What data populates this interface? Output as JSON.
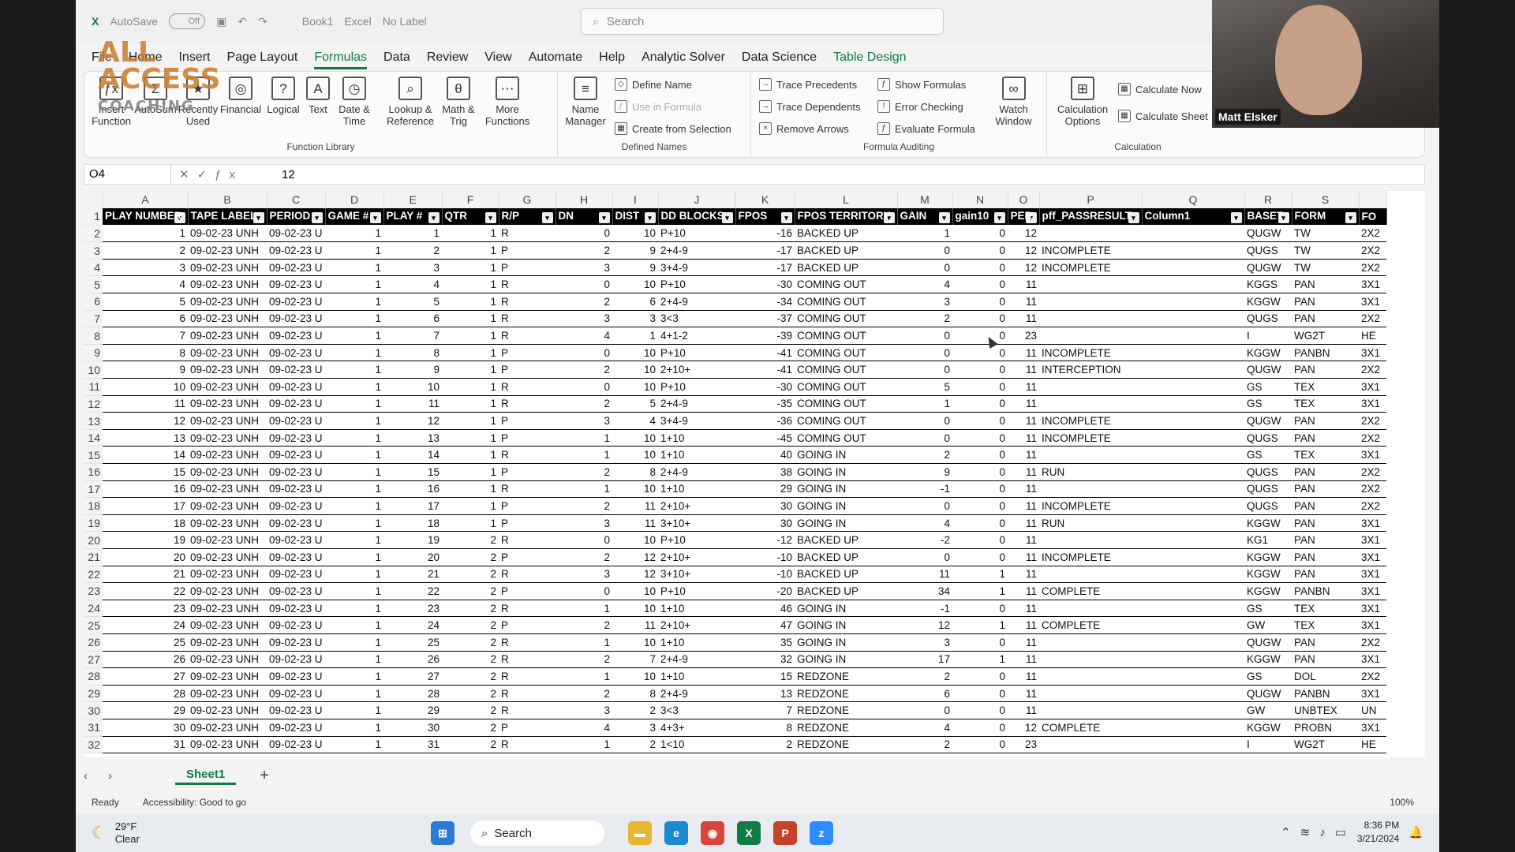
{
  "titlebar": {
    "autosave": "AutoSave",
    "autosave_state": "Off",
    "book": "Book1",
    "app": "Excel",
    "label": "No Label",
    "search_placeholder": "Search"
  },
  "logo": {
    "line1": "ALL ACCESS",
    "line2": "COACHING"
  },
  "menu_tabs": [
    "File",
    "Home",
    "Insert",
    "Page Layout",
    "Formulas",
    "Data",
    "Review",
    "View",
    "Automate",
    "Help",
    "Analytic Solver",
    "Data Science",
    "Table Design"
  ],
  "active_tab": "Formulas",
  "ribbon": {
    "function_library": {
      "label": "Function Library",
      "buttons": [
        {
          "label": "Insert Function",
          "icon": "fx-icon"
        },
        {
          "label": "AutoSum",
          "icon": "sigma-icon"
        },
        {
          "label": "Recently Used",
          "icon": "star-icon"
        },
        {
          "label": "Financial",
          "icon": "coins-icon"
        },
        {
          "label": "Logical",
          "icon": "question-icon"
        },
        {
          "label": "Text",
          "icon": "text-icon"
        },
        {
          "label": "Date & Time",
          "icon": "clock-icon"
        },
        {
          "label": "Lookup & Reference",
          "icon": "magnifier-icon"
        },
        {
          "label": "Math & Trig",
          "icon": "theta-icon"
        },
        {
          "label": "More Functions",
          "icon": "dots-icon"
        }
      ]
    },
    "defined_names": {
      "label": "Defined Names",
      "name_manager": "Name Manager",
      "define_name": "Define Name",
      "use_in_formula": "Use in Formula",
      "create_from_selection": "Create from Selection"
    },
    "formula_auditing": {
      "label": "Formula Auditing",
      "trace_precedents": "Trace Precedents",
      "trace_dependents": "Trace Dependents",
      "remove_arrows": "Remove Arrows",
      "show_formulas": "Show Formulas",
      "error_checking": "Error Checking",
      "evaluate_formula": "Evaluate Formula",
      "watch_window": "Watch Window"
    },
    "calculation": {
      "label": "Calculation",
      "calculation_options": "Calculation Options",
      "calculate_now": "Calculate Now",
      "calculate_sheet": "Calculate Sheet"
    }
  },
  "formula_bar": {
    "name_box": "O4",
    "value": "12"
  },
  "column_letters": [
    "A",
    "B",
    "C",
    "D",
    "E",
    "F",
    "G",
    "H",
    "I",
    "J",
    "K",
    "L",
    "M",
    "N",
    "O",
    "P",
    "Q",
    "R",
    "S",
    ""
  ],
  "header_cells": [
    "PLAY NUMBER",
    "TAPE LABEL",
    "PERIOD",
    "GAME #",
    "PLAY #",
    "QTR",
    "R/P",
    "DN",
    "DIST",
    "DD BLOCKS",
    "FPOS",
    "FPOS TERRITORY",
    "GAIN",
    "gain10",
    "PER",
    "pff_PASSRESULT",
    "Column1",
    "BASET",
    "FORM",
    "FO"
  ],
  "rows": [
    [
      "1",
      "09-02-23 UNH",
      "09-02-23 U",
      "1",
      "1",
      "1",
      "R",
      "0",
      "10",
      "P+10",
      "-16",
      "BACKED UP",
      "1",
      "0",
      "12",
      "",
      "",
      "QUGW",
      "TW",
      "2X2"
    ],
    [
      "2",
      "09-02-23 UNH",
      "09-02-23 U",
      "1",
      "2",
      "1",
      "P",
      "2",
      "9",
      "2+4-9",
      "-17",
      "BACKED UP",
      "0",
      "0",
      "12",
      "INCOMPLETE",
      "",
      "QUGS",
      "TW",
      "2X2"
    ],
    [
      "3",
      "09-02-23 UNH",
      "09-02-23 U",
      "1",
      "3",
      "1",
      "P",
      "3",
      "9",
      "3+4-9",
      "-17",
      "BACKED UP",
      "0",
      "0",
      "12",
      "INCOMPLETE",
      "",
      "QUGW",
      "TW",
      "2X2"
    ],
    [
      "4",
      "09-02-23 UNH",
      "09-02-23 U",
      "1",
      "4",
      "1",
      "R",
      "0",
      "10",
      "P+10",
      "-30",
      "COMING OUT",
      "4",
      "0",
      "11",
      "",
      "",
      "KGGS",
      "PAN",
      "3X1"
    ],
    [
      "5",
      "09-02-23 UNH",
      "09-02-23 U",
      "1",
      "5",
      "1",
      "R",
      "2",
      "6",
      "2+4-9",
      "-34",
      "COMING OUT",
      "3",
      "0",
      "11",
      "",
      "",
      "KGGW",
      "PAN",
      "3X1"
    ],
    [
      "6",
      "09-02-23 UNH",
      "09-02-23 U",
      "1",
      "6",
      "1",
      "R",
      "3",
      "3",
      "3<3",
      "-37",
      "COMING OUT",
      "2",
      "0",
      "11",
      "",
      "",
      "QUGS",
      "PAN",
      "2X2"
    ],
    [
      "7",
      "09-02-23 UNH",
      "09-02-23 U",
      "1",
      "7",
      "1",
      "R",
      "4",
      "1",
      "4+1-2",
      "-39",
      "COMING OUT",
      "0",
      "0",
      "23",
      "",
      "",
      "I",
      "WG2T",
      "HE"
    ],
    [
      "8",
      "09-02-23 UNH",
      "09-02-23 U",
      "1",
      "8",
      "1",
      "P",
      "0",
      "10",
      "P+10",
      "-41",
      "COMING OUT",
      "0",
      "0",
      "11",
      "INCOMPLETE",
      "",
      "KGGW",
      "PANBN",
      "3X1"
    ],
    [
      "9",
      "09-02-23 UNH",
      "09-02-23 U",
      "1",
      "9",
      "1",
      "P",
      "2",
      "10",
      "2+10+",
      "-41",
      "COMING OUT",
      "0",
      "0",
      "11",
      "INTERCEPTION",
      "",
      "QUGW",
      "PAN",
      "2X2"
    ],
    [
      "10",
      "09-02-23 UNH",
      "09-02-23 U",
      "1",
      "10",
      "1",
      "R",
      "0",
      "10",
      "P+10",
      "-30",
      "COMING OUT",
      "5",
      "0",
      "11",
      "",
      "",
      "GS",
      "TEX",
      "3X1"
    ],
    [
      "11",
      "09-02-23 UNH",
      "09-02-23 U",
      "1",
      "11",
      "1",
      "R",
      "2",
      "5",
      "2+4-9",
      "-35",
      "COMING OUT",
      "1",
      "0",
      "11",
      "",
      "",
      "GS",
      "TEX",
      "3X1"
    ],
    [
      "12",
      "09-02-23 UNH",
      "09-02-23 U",
      "1",
      "12",
      "1",
      "P",
      "3",
      "4",
      "3+4-9",
      "-36",
      "COMING OUT",
      "0",
      "0",
      "11",
      "INCOMPLETE",
      "",
      "QUGW",
      "PAN",
      "2X2"
    ],
    [
      "13",
      "09-02-23 UNH",
      "09-02-23 U",
      "1",
      "13",
      "1",
      "P",
      "1",
      "10",
      "1+10",
      "-45",
      "COMING OUT",
      "0",
      "0",
      "11",
      "INCOMPLETE",
      "",
      "QUGS",
      "PAN",
      "2X2"
    ],
    [
      "14",
      "09-02-23 UNH",
      "09-02-23 U",
      "1",
      "14",
      "1",
      "R",
      "1",
      "10",
      "1+10",
      "40",
      "GOING IN",
      "2",
      "0",
      "11",
      "",
      "",
      "GS",
      "TEX",
      "3X1"
    ],
    [
      "15",
      "09-02-23 UNH",
      "09-02-23 U",
      "1",
      "15",
      "1",
      "P",
      "2",
      "8",
      "2+4-9",
      "38",
      "GOING IN",
      "9",
      "0",
      "11",
      "RUN",
      "",
      "QUGS",
      "PAN",
      "2X2"
    ],
    [
      "16",
      "09-02-23 UNH",
      "09-02-23 U",
      "1",
      "16",
      "1",
      "R",
      "1",
      "10",
      "1+10",
      "29",
      "GOING IN",
      "-1",
      "0",
      "11",
      "",
      "",
      "QUGS",
      "PAN",
      "2X2"
    ],
    [
      "17",
      "09-02-23 UNH",
      "09-02-23 U",
      "1",
      "17",
      "1",
      "P",
      "2",
      "11",
      "2+10+",
      "30",
      "GOING IN",
      "0",
      "0",
      "11",
      "INCOMPLETE",
      "",
      "QUGS",
      "PAN",
      "2X2"
    ],
    [
      "18",
      "09-02-23 UNH",
      "09-02-23 U",
      "1",
      "18",
      "1",
      "P",
      "3",
      "11",
      "3+10+",
      "30",
      "GOING IN",
      "4",
      "0",
      "11",
      "RUN",
      "",
      "KGGW",
      "PAN",
      "3X1"
    ],
    [
      "19",
      "09-02-23 UNH",
      "09-02-23 U",
      "1",
      "19",
      "2",
      "R",
      "0",
      "10",
      "P+10",
      "-12",
      "BACKED UP",
      "-2",
      "0",
      "11",
      "",
      "",
      "KG1",
      "PAN",
      "3X1"
    ],
    [
      "20",
      "09-02-23 UNH",
      "09-02-23 U",
      "1",
      "20",
      "2",
      "P",
      "2",
      "12",
      "2+10+",
      "-10",
      "BACKED UP",
      "0",
      "0",
      "11",
      "INCOMPLETE",
      "",
      "KGGW",
      "PAN",
      "3X1"
    ],
    [
      "21",
      "09-02-23 UNH",
      "09-02-23 U",
      "1",
      "21",
      "2",
      "R",
      "3",
      "12",
      "3+10+",
      "-10",
      "BACKED UP",
      "11",
      "1",
      "11",
      "",
      "",
      "KGGW",
      "PAN",
      "3X1"
    ],
    [
      "22",
      "09-02-23 UNH",
      "09-02-23 U",
      "1",
      "22",
      "2",
      "P",
      "0",
      "10",
      "P+10",
      "-20",
      "BACKED UP",
      "34",
      "1",
      "11",
      "COMPLETE",
      "",
      "KGGW",
      "PANBN",
      "3X1"
    ],
    [
      "23",
      "09-02-23 UNH",
      "09-02-23 U",
      "1",
      "23",
      "2",
      "R",
      "1",
      "10",
      "1+10",
      "46",
      "GOING IN",
      "-1",
      "0",
      "11",
      "",
      "",
      "GS",
      "TEX",
      "3X1"
    ],
    [
      "24",
      "09-02-23 UNH",
      "09-02-23 U",
      "1",
      "24",
      "2",
      "P",
      "2",
      "11",
      "2+10+",
      "47",
      "GOING IN",
      "12",
      "1",
      "11",
      "COMPLETE",
      "",
      "GW",
      "TEX",
      "3X1"
    ],
    [
      "25",
      "09-02-23 UNH",
      "09-02-23 U",
      "1",
      "25",
      "2",
      "R",
      "1",
      "10",
      "1+10",
      "35",
      "GOING IN",
      "3",
      "0",
      "11",
      "",
      "",
      "QUGW",
      "PAN",
      "2X2"
    ],
    [
      "26",
      "09-02-23 UNH",
      "09-02-23 U",
      "1",
      "26",
      "2",
      "R",
      "2",
      "7",
      "2+4-9",
      "32",
      "GOING IN",
      "17",
      "1",
      "11",
      "",
      "",
      "KGGW",
      "PAN",
      "3X1"
    ],
    [
      "27",
      "09-02-23 UNH",
      "09-02-23 U",
      "1",
      "27",
      "2",
      "R",
      "1",
      "10",
      "1+10",
      "15",
      "REDZONE",
      "2",
      "0",
      "11",
      "",
      "",
      "GS",
      "DOL",
      "2X2"
    ],
    [
      "28",
      "09-02-23 UNH",
      "09-02-23 U",
      "1",
      "28",
      "2",
      "R",
      "2",
      "8",
      "2+4-9",
      "13",
      "REDZONE",
      "6",
      "0",
      "11",
      "",
      "",
      "QUGW",
      "PANBN",
      "3X1"
    ],
    [
      "29",
      "09-02-23 UNH",
      "09-02-23 U",
      "1",
      "29",
      "2",
      "R",
      "3",
      "2",
      "3<3",
      "7",
      "REDZONE",
      "0",
      "0",
      "11",
      "",
      "",
      "GW",
      "UNBTEX",
      "UN"
    ],
    [
      "30",
      "09-02-23 UNH",
      "09-02-23 U",
      "1",
      "30",
      "2",
      "P",
      "4",
      "3",
      "4+3+",
      "8",
      "REDZONE",
      "4",
      "0",
      "12",
      "COMPLETE",
      "",
      "KGGW",
      "PROBN",
      "3X1"
    ],
    [
      "31",
      "09-02-23 UNH",
      "09-02-23 U",
      "1",
      "31",
      "2",
      "R",
      "1",
      "2",
      "1<10",
      "2",
      "REDZONE",
      "2",
      "0",
      "23",
      "",
      "",
      "I",
      "WG2T",
      "HE"
    ]
  ],
  "sheet_tabs": [
    "Sheet1"
  ],
  "status": {
    "ready": "Ready",
    "accessibility": "Accessibility: Good to go",
    "zoom": "100%"
  },
  "taskbar": {
    "weather_temp": "29°F",
    "weather_desc": "Clear",
    "search": "Search",
    "time": "8:36 PM",
    "date": "3/21/2024"
  },
  "webcam": {
    "participant": "Matt Elsker"
  },
  "colors": {
    "accent": "#107c41",
    "header_bg": "#000000"
  }
}
